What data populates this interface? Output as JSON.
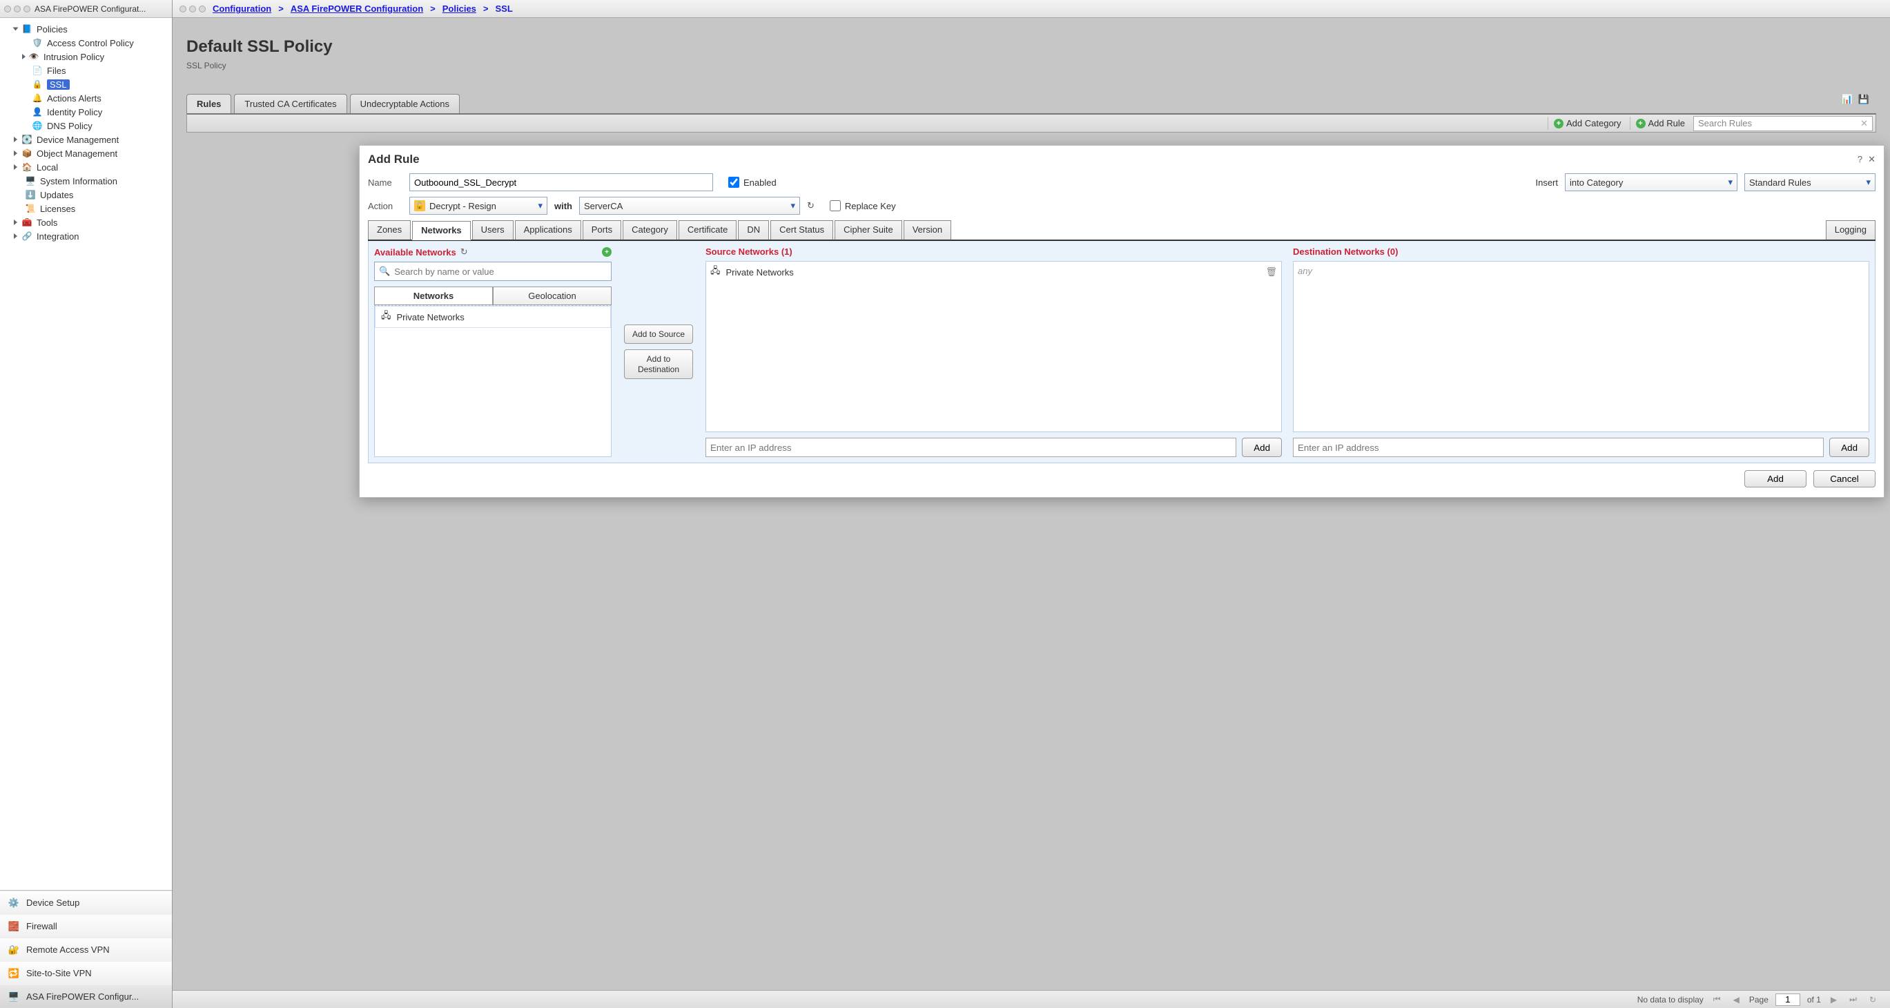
{
  "window": {
    "title": "ASA FirePOWER Configurat..."
  },
  "tree": {
    "root": "Policies",
    "items": [
      {
        "label": "Access Control Policy",
        "icon": "policy"
      },
      {
        "label": "Intrusion Policy",
        "icon": "eye",
        "expand": true
      },
      {
        "label": "Files",
        "icon": "file"
      },
      {
        "label": "SSL",
        "icon": "lock",
        "selected": true
      },
      {
        "label": "Actions Alerts",
        "icon": "alert"
      },
      {
        "label": "Identity Policy",
        "icon": "user"
      },
      {
        "label": "DNS Policy",
        "icon": "globe"
      }
    ],
    "siblings": [
      {
        "label": "Device Management",
        "icon": "device",
        "expand": true
      },
      {
        "label": "Object Management",
        "icon": "object",
        "expand": true
      },
      {
        "label": "Local",
        "icon": "home",
        "expand": true
      },
      {
        "label": "System Information",
        "icon": "sys"
      },
      {
        "label": "Updates",
        "icon": "update"
      },
      {
        "label": "Licenses",
        "icon": "license"
      },
      {
        "label": "Tools",
        "icon": "tools",
        "expand": true
      },
      {
        "label": "Integration",
        "icon": "integ",
        "expand": true
      }
    ]
  },
  "sb_bottom": [
    {
      "label": "Device Setup",
      "icon": "gear"
    },
    {
      "label": "Firewall",
      "icon": "wall"
    },
    {
      "label": "Remote Access VPN",
      "icon": "vpn"
    },
    {
      "label": "Site-to-Site VPN",
      "icon": "s2s"
    },
    {
      "label": "ASA FirePOWER Configur...",
      "icon": "fp",
      "active": true
    }
  ],
  "breadcrumb": [
    "Configuration",
    "ASA FirePOWER Configuration",
    "Policies",
    "SSL"
  ],
  "page": {
    "title": "Default SSL Policy",
    "subtitle": "SSL Policy",
    "tabs": [
      "Rules",
      "Trusted CA Certificates",
      "Undecryptable Actions"
    ],
    "active_tab": "Rules",
    "toolbar": {
      "add_category": "Add Category",
      "add_rule": "Add Rule",
      "search_ph": "Search Rules"
    }
  },
  "dialog": {
    "title": "Add Rule",
    "name_label": "Name",
    "name_value": "Outboound_SSL_Decrypt",
    "enabled_label": "Enabled",
    "enabled": true,
    "insert_label": "Insert",
    "insert_value": "into Category",
    "insert_cat": "Standard Rules",
    "action_label": "Action",
    "action_value": "Decrypt - Resign",
    "with_label": "with",
    "with_value": "ServerCA",
    "replace_label": "Replace Key",
    "replace": false,
    "tabs": [
      "Zones",
      "Networks",
      "Users",
      "Applications",
      "Ports",
      "Category",
      "Certificate",
      "DN",
      "Cert Status",
      "Cipher Suite",
      "Version"
    ],
    "active_tab": "Networks",
    "logging_tab": "Logging",
    "avail": {
      "title": "Available Networks",
      "search_ph": "Search by name or value",
      "subtabs": [
        "Networks",
        "Geolocation"
      ],
      "active_sub": "Networks",
      "items": [
        "Private Networks"
      ]
    },
    "mid": {
      "to_src": "Add to Source",
      "to_dst": "Add to Destination"
    },
    "src": {
      "title": "Source Networks (1)",
      "items": [
        "Private Networks"
      ],
      "ip_ph": "Enter an IP address",
      "add": "Add"
    },
    "dst": {
      "title": "Destination Networks (0)",
      "empty": "any",
      "ip_ph": "Enter an IP address",
      "add": "Add"
    },
    "foot": {
      "add": "Add",
      "cancel": "Cancel"
    }
  },
  "pager": {
    "nodata": "No data to display",
    "page": "Page",
    "page_num": "1",
    "of": "of 1"
  }
}
